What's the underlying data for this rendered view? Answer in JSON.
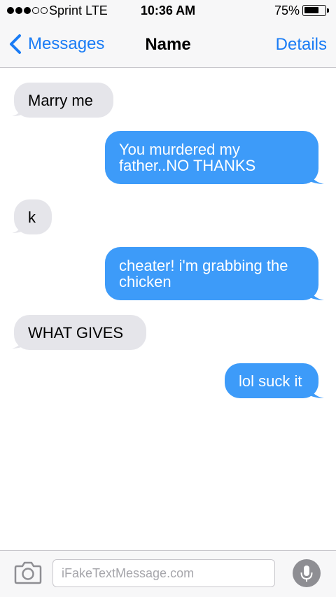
{
  "status_bar": {
    "signal_full": 3,
    "signal_total": 5,
    "carrier": "Sprint  LTE",
    "time": "10:36 AM",
    "battery_percent": "75%",
    "battery_level": 0.75
  },
  "nav": {
    "back_label": "Messages",
    "back_icon": "chevron-left-icon",
    "title": "Name",
    "details_label": "Details"
  },
  "messages": [
    {
      "direction": "received",
      "text": "Marry me"
    },
    {
      "direction": "sent",
      "text": "You murdered my father..NO THANKS"
    },
    {
      "direction": "received",
      "text": "k"
    },
    {
      "direction": "sent",
      "text": "cheater! i'm grabbing the chicken"
    },
    {
      "direction": "received",
      "text": "WHAT GIVES"
    },
    {
      "direction": "sent",
      "text": "lol suck it"
    }
  ],
  "input_bar": {
    "camera_icon": "camera-icon",
    "placeholder": "iFakeTextMessage.com",
    "mic_icon": "microphone-icon"
  },
  "colors": {
    "accent": "#1a7cf5",
    "sent_bubble": "#3d9bf9",
    "received_bubble": "#e5e5ea",
    "bar_background": "#f7f7f8"
  }
}
